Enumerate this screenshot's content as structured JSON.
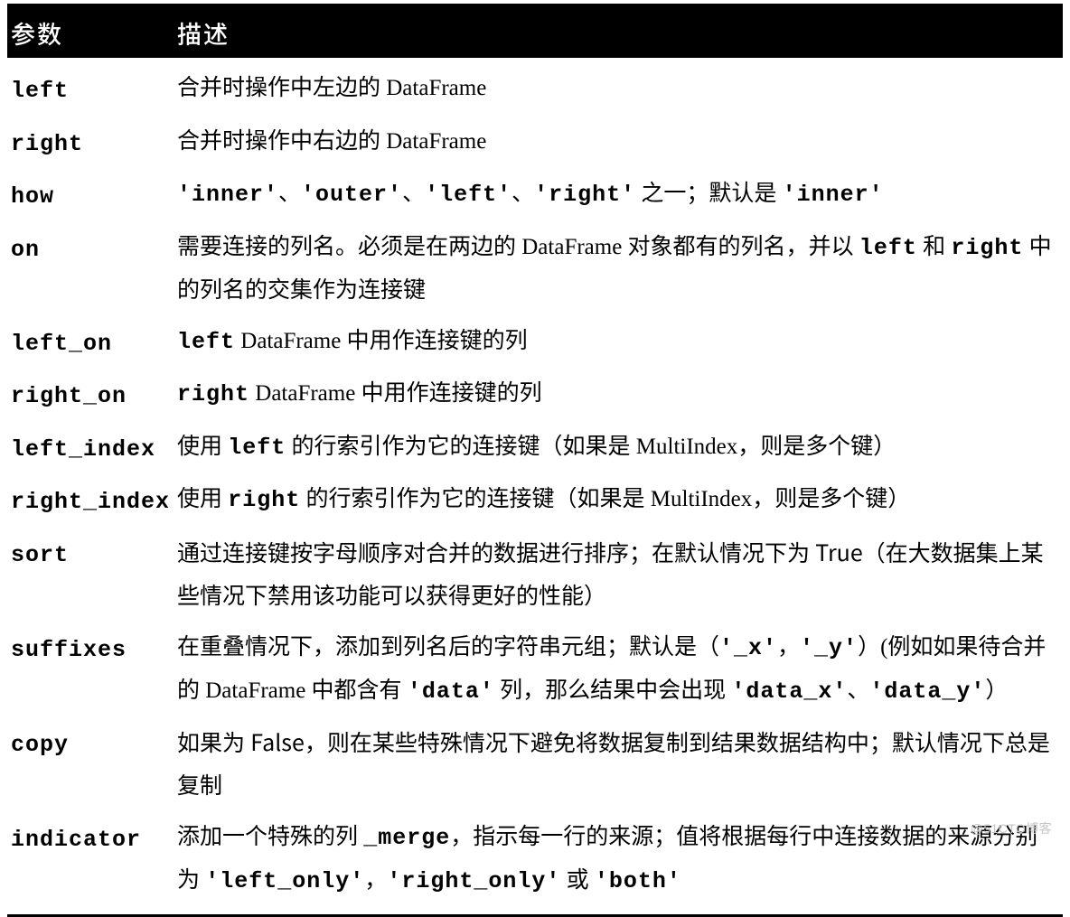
{
  "header": {
    "param": "参数",
    "desc": "描述"
  },
  "rows": [
    {
      "param": "left",
      "desc_html": "合并时操作中左边的 DataFrame"
    },
    {
      "param": "right",
      "desc_html": "合并时操作中右边的 DataFrame"
    },
    {
      "param": "how",
      "desc_html": "<code>'inner'</code>、<code>'outer'</code>、<code>'left'</code>、<code>'right'</code> 之一；默认是 <code>'inner'</code>"
    },
    {
      "param": "on",
      "desc_html": "需要连接的列名。必须是在两边的 DataFrame 对象都有的列名，并以 <code>left</code> 和 <code>right</code> 中的列名的交集作为连接键"
    },
    {
      "param": "left_on",
      "desc_html": "<code>left</code>  DataFrame 中用作连接键的列"
    },
    {
      "param": "right_on",
      "desc_html": "<code>right</code>  DataFrame 中用作连接键的列"
    },
    {
      "param": "left_index",
      "desc_html": "使用 <code>left</code> 的行索引作为它的连接键（如果是 MultiIndex，则是多个键）"
    },
    {
      "param": "right_index",
      "desc_html": "使用 <code>right</code> 的行索引作为它的连接键（如果是 MultiIndex，则是多个键）"
    },
    {
      "param": "sort",
      "desc_html": "通过连接键按字母顺序对合并的数据进行排序；在默认情况下为 <span class='sans'>True</span>（在大数据集上某些情况下禁用该功能可以获得更好的性能）"
    },
    {
      "param": "suffixes",
      "desc_html": "在重叠情况下，添加到列名后的字符串元组；默认是（<code>'_x'</code>，<code>'_y'</code>）(例如如果待合并的 DataFrame 中都含有 <code>'data'</code> 列，那么结果中会出现 <code>'data_x'</code>、<code>'data_y'</code>）"
    },
    {
      "param": "copy",
      "desc_html": "如果为 <span class='sans'>False</span>，则在某些特殊情况下避免将数据复制到结果数据结构中；默认情况下总是复制"
    },
    {
      "param": "indicator",
      "desc_html": "添加一个特殊的列 <code>_merge</code>，指示每一行的来源；值将根据每行中连接数据的来源分别为 <code>'left_only'</code>，<code>'right_only'</code> 或 <code>'both'</code>"
    }
  ],
  "watermark": "@51CTO博客"
}
